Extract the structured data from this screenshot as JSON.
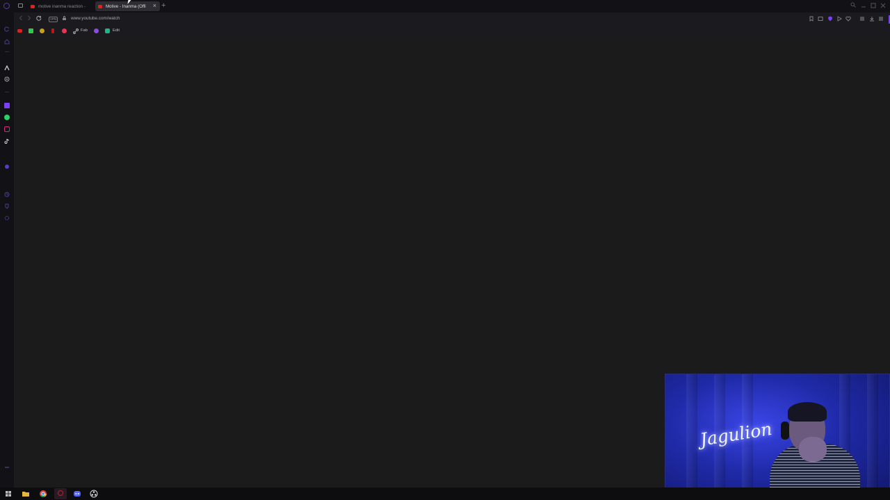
{
  "browser": {
    "tabs": [
      {
        "title": "motive inanma reaction -",
        "active": false
      },
      {
        "title": "Motive - İnanma (Offi",
        "active": true
      }
    ],
    "new_tab": "+",
    "close_glyph": "×",
    "vpn_badge": "VPN",
    "url": "www.youtube.com/watch"
  },
  "bookmarks": [
    {
      "label": "Fab"
    },
    {
      "label": "Edit"
    }
  ],
  "webcam": {
    "neon_sign": "Jagulion"
  },
  "colors": {
    "accent": "#7a42f4",
    "youtube_red": "#e0221a",
    "webcam_blue": "#2b36d0"
  }
}
